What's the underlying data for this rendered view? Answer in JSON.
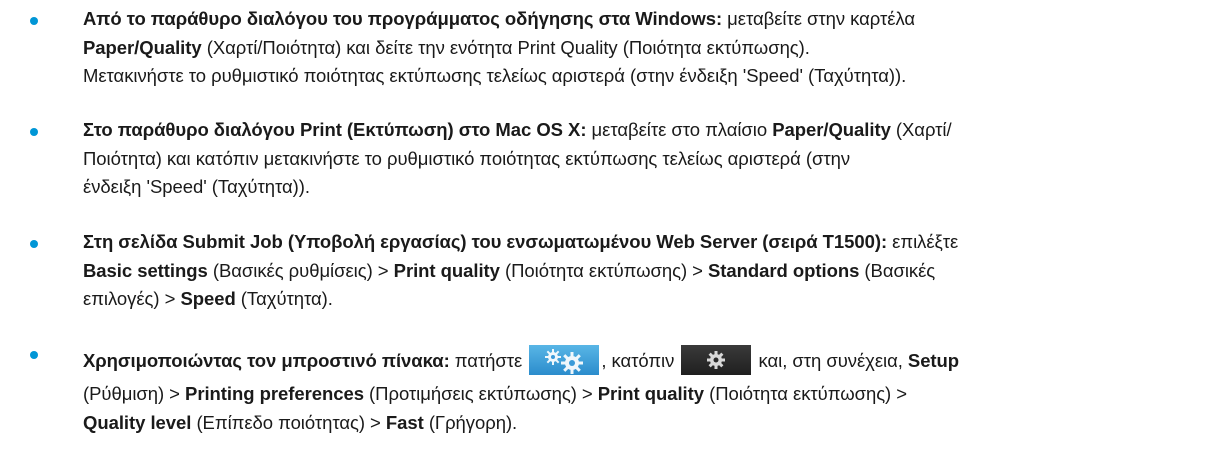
{
  "items": [
    {
      "lines": [
        [
          {
            "b": true,
            "t": "Από το παράθυρο διαλόγου του προγράμματος οδήγησης στα Windows:"
          },
          {
            "b": false,
            "t": " μεταβείτε στην καρτέλα"
          }
        ],
        [
          {
            "b": true,
            "t": "Paper/Quality"
          },
          {
            "b": false,
            "t": " (Χαρτί/Ποιότητα) και δείτε την ενότητα Print Quality (Ποιότητα εκτύπωσης)."
          }
        ],
        [
          {
            "b": false,
            "t": "Μετακινήστε το ρυθμιστικό ποιότητας εκτύπωσης τελείως αριστερά (στην ένδειξη 'Speed' (Ταχύτητα))."
          }
        ]
      ]
    },
    {
      "lines": [
        [
          {
            "b": true,
            "t": "Στο παράθυρο διαλόγου Print (Εκτύπωση) στο Mac OS X:"
          },
          {
            "b": false,
            "t": " μεταβείτε στο πλαίσιο "
          },
          {
            "b": true,
            "t": "Paper/Quality"
          },
          {
            "b": false,
            "t": " (Χαρτί/"
          }
        ],
        [
          {
            "b": false,
            "t": "Ποιότητα) και κατόπιν μετακινήστε το ρυθμιστικό ποιότητας εκτύπωσης τελείως αριστερά (στην"
          }
        ],
        [
          {
            "b": false,
            "t": "ένδειξη 'Speed' (Ταχύτητα))."
          }
        ]
      ]
    },
    {
      "lines": [
        [
          {
            "b": true,
            "t": "Στη σελίδα Submit Job (Υποβολή εργασίας) του ενσωματωμένου Web Server (σειρά T1500):"
          },
          {
            "b": false,
            "t": " επιλέξτε"
          }
        ],
        [
          {
            "b": true,
            "t": "Basic settings"
          },
          {
            "b": false,
            "t": " (Βασικές ρυθμίσεις) > "
          },
          {
            "b": true,
            "t": "Print quality"
          },
          {
            "b": false,
            "t": " (Ποιότητα εκτύπωσης) > "
          },
          {
            "b": true,
            "t": "Standard options"
          },
          {
            "b": false,
            "t": " (Βασικές"
          }
        ],
        [
          {
            "b": false,
            "t": "επιλογές) > "
          },
          {
            "b": true,
            "t": "Speed"
          },
          {
            "b": false,
            "t": " (Ταχύτητα)."
          }
        ]
      ]
    },
    {
      "line1": {
        "bold_lead": "Χρησιμοποιώντας τον μπροστινό πίνακα:",
        "press": " πατήστε ",
        "then": ", κατόπιν ",
        "and_then": " και, στη συνέχεια, ",
        "setup": "Setup"
      },
      "lines": [
        [
          {
            "b": false,
            "t": "(Ρύθμιση) > "
          },
          {
            "b": true,
            "t": "Printing preferences"
          },
          {
            "b": false,
            "t": " (Προτιμήσεις εκτύπωσης) > "
          },
          {
            "b": true,
            "t": "Print quality"
          },
          {
            "b": false,
            "t": " (Ποιότητα εκτύπωσης) >"
          }
        ],
        [
          {
            "b": true,
            "t": "Quality level"
          },
          {
            "b": false,
            "t": " (Επίπεδο ποιότητας) > "
          },
          {
            "b": true,
            "t": "Fast"
          },
          {
            "b": false,
            "t": " (Γρήγορη)."
          }
        ]
      ],
      "icons": [
        "settings-gears-icon",
        "gear-icon"
      ]
    }
  ],
  "colors": {
    "bullet": "#0096d6",
    "text": "#1a1a1a",
    "button_blue": "#3a9ad9",
    "button_dark": "#2a2a2a"
  }
}
